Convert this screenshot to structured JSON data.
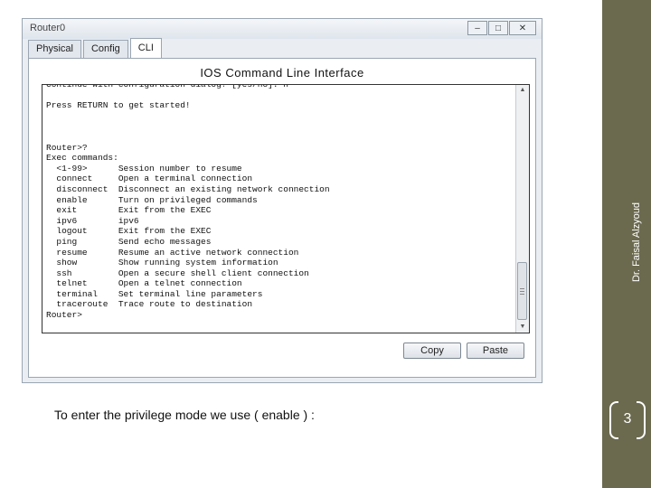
{
  "window": {
    "title": "Router0",
    "controls": {
      "minimize": "–",
      "maximize": "□",
      "close": "✕"
    },
    "tabs": [
      "Physical",
      "Config",
      "CLI"
    ],
    "active_tab": "CLI"
  },
  "panel": {
    "title": "IOS Command Line Interface",
    "cli_text": "Continue with configuration dialog? [yes/no]: n\n\nPress RETURN to get started!\n\n\n\nRouter>?\nExec commands:\n  <1-99>      Session number to resume\n  connect     Open a terminal connection\n  disconnect  Disconnect an existing network connection\n  enable      Turn on privileged commands\n  exit        Exit from the EXEC\n  ipv6        ipv6\n  logout      Exit from the EXEC\n  ping        Send echo messages\n  resume      Resume an active network connection\n  show        Show running system information\n  ssh         Open a secure shell client connection\n  telnet      Open a telnet connection\n  terminal    Set terminal line parameters\n  traceroute  Trace route to destination\nRouter>",
    "copy_label": "Copy",
    "paste_label": "Paste"
  },
  "caption": "To enter the privilege mode we use ( enable ) :",
  "sidebar": {
    "author": "Dr. Faisal Alzyoud",
    "page_number": "3"
  },
  "colors": {
    "sidebar": "#6b6a4f",
    "window_bg": "#eaeef3"
  }
}
